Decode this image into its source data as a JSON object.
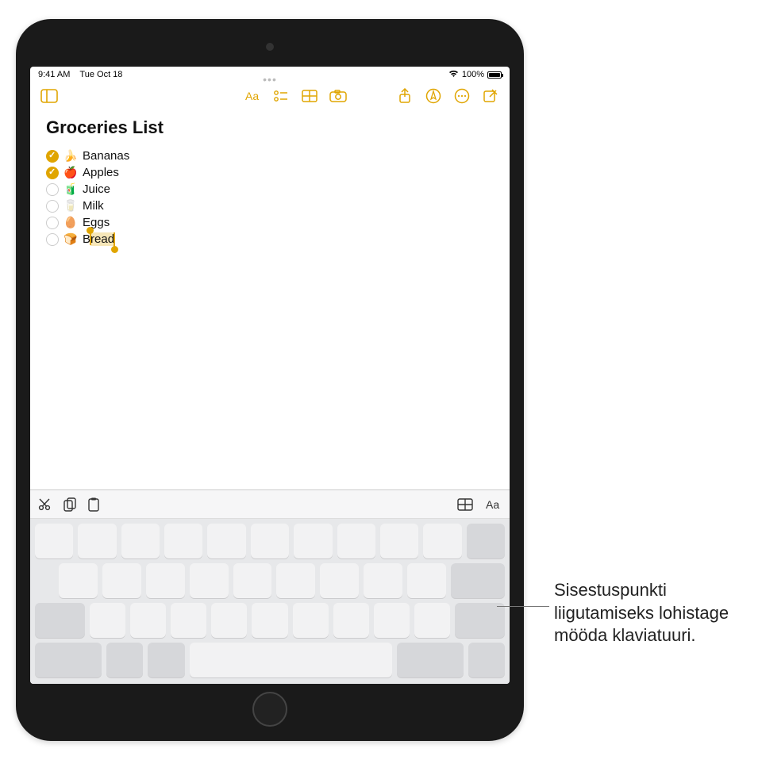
{
  "status_bar": {
    "time": "9:41 AM",
    "date": "Tue Oct 18",
    "battery_text": "100%"
  },
  "toolbar_overflow": "•••",
  "note": {
    "title": "Groceries List",
    "items": [
      {
        "checked": true,
        "emoji": "🍌",
        "text": "Bananas"
      },
      {
        "checked": true,
        "emoji": "🍎",
        "text": "Apples"
      },
      {
        "checked": false,
        "emoji": "🧃",
        "text": "Juice"
      },
      {
        "checked": false,
        "emoji": "🥛",
        "text": "Milk"
      },
      {
        "checked": false,
        "emoji": "🥚",
        "text": "Eggs"
      },
      {
        "checked": false,
        "emoji": "🍞",
        "text": "Bread"
      }
    ],
    "selection_item_index": 5,
    "selection_text": "read"
  },
  "callout": {
    "text": "Sisestuspunkti liigutamiseks lohistage mööda klaviatuuri."
  },
  "colors": {
    "accent": "#e0a500"
  }
}
